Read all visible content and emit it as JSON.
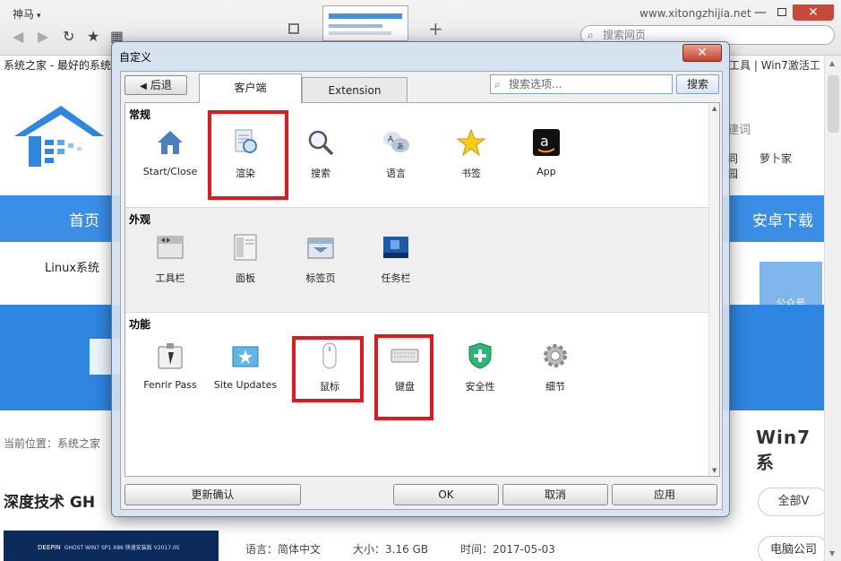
{
  "browser": {
    "app_name": "神马",
    "domain": "www.xitongzhijia.net",
    "search_placeholder": "搜索网页"
  },
  "page": {
    "tab_title": "系统之家 - 最好的系统",
    "top_right_links": [
      "工具",
      "Win7激活工"
    ],
    "search_hint": "建词",
    "nav_right_links": [
      "同",
      "萝卜家园"
    ],
    "blue_nav": [
      "首页",
      "安卓下载"
    ],
    "subnav": "Linux系统",
    "wechat_label": "公众号",
    "breadcrumb": "当前位置：系统之家",
    "win7_heading": "Win7系",
    "article_title": "深度技术 GH",
    "side_buttons": [
      "全部V",
      "电脑公司"
    ],
    "thumb_caption": "GHOST WIN7 SP1 X86 快速安装版 V2017.05",
    "thumb_logo": "DEEPIN",
    "meta": {
      "language": "语言：简体中文",
      "size": "大小：3.16 GB",
      "time": "时间：2017-05-03"
    }
  },
  "dialog": {
    "title": "自定义",
    "close": "✕",
    "back_label": "后退",
    "tabs": [
      "客户端",
      "Extension"
    ],
    "search_placeholder": "搜索选项...",
    "search_button": "搜索",
    "sections": [
      {
        "title": "常规",
        "items": [
          "Start/Close",
          "渲染",
          "搜索",
          "语言",
          "书签",
          "App"
        ]
      },
      {
        "title": "外观",
        "items": [
          "工具栏",
          "面板",
          "标签页",
          "任务栏"
        ]
      },
      {
        "title": "功能",
        "items": [
          "Fenrir Pass",
          "Site Updates",
          "鼠标",
          "键盘",
          "安全性",
          "细节"
        ]
      }
    ],
    "buttons": {
      "refresh": "更新确认",
      "ok": "OK",
      "cancel": "取消",
      "apply": "应用"
    }
  },
  "colors": {
    "highlight": "#e0191e",
    "brand_blue": "#3a8ee6",
    "close_red": "#c9483b"
  }
}
